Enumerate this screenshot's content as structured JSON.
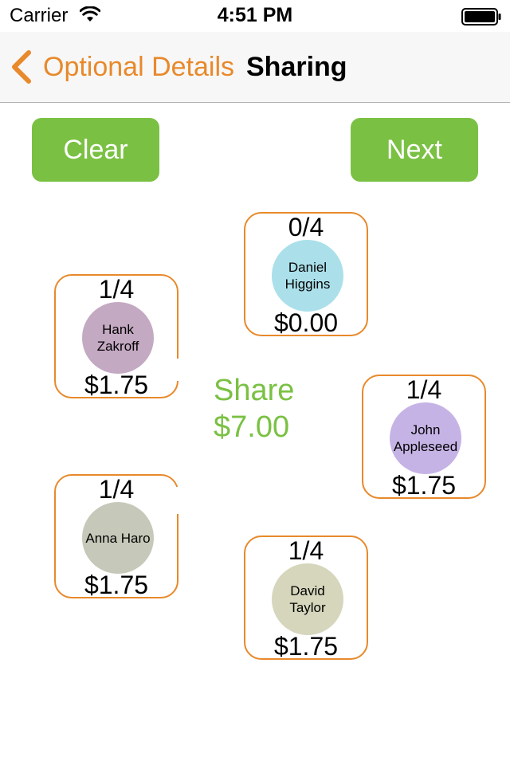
{
  "status_bar": {
    "carrier": "Carrier",
    "time": "4:51 PM",
    "wifi_icon": "wifi-icon",
    "battery_icon": "battery-full-icon"
  },
  "nav": {
    "back_label": "Optional Details",
    "title": "Sharing",
    "back_icon": "chevron-left-icon"
  },
  "buttons": {
    "clear": "Clear",
    "next": "Next"
  },
  "share": {
    "label": "Share",
    "total": "$7.00"
  },
  "people": [
    {
      "name": "Daniel Higgins",
      "count": "0/4",
      "amount": "$0.00",
      "color": "#abe0ea"
    },
    {
      "name": "Hank Zakroff",
      "count": "1/4",
      "amount": "$1.75",
      "color": "#c4a9c3"
    },
    {
      "name": "John Appleseed",
      "count": "1/4",
      "amount": "$1.75",
      "color": "#c6b3e6"
    },
    {
      "name": "Anna Haro",
      "count": "1/4",
      "amount": "$1.75",
      "color": "#c6c8b9"
    },
    {
      "name": "David Taylor",
      "count": "1/4",
      "amount": "$1.75",
      "color": "#d6d6bd"
    }
  ],
  "colors": {
    "accent_orange": "#e8892b",
    "accent_green": "#7ac143"
  }
}
